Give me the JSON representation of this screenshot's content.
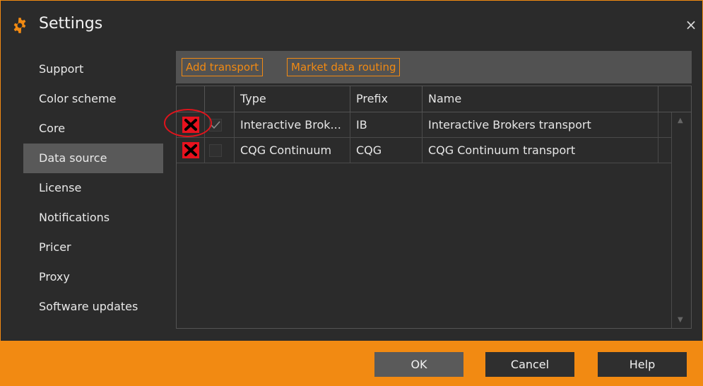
{
  "window": {
    "title": "Settings",
    "close_symbol": "×"
  },
  "sidebar": {
    "items": [
      {
        "label": "Support"
      },
      {
        "label": "Color scheme"
      },
      {
        "label": "Core"
      },
      {
        "label": "Data source",
        "active": true
      },
      {
        "label": "License"
      },
      {
        "label": "Notifications"
      },
      {
        "label": "Pricer"
      },
      {
        "label": "Proxy"
      },
      {
        "label": "Software updates"
      }
    ]
  },
  "toolbar": {
    "add_transport": "Add transport",
    "market_data_routing": "Market data routing"
  },
  "table": {
    "columns": [
      "Type",
      "Prefix",
      "Name"
    ],
    "rows": [
      {
        "type": "Interactive Brok...",
        "prefix": "IB",
        "name": "Interactive Brokers transport",
        "enabled": true
      },
      {
        "type": "CQG Continuum",
        "prefix": "CQG",
        "name": "CQG Continuum transport",
        "enabled": false
      }
    ]
  },
  "footer": {
    "ok": "OK",
    "cancel": "Cancel",
    "help": "Help"
  },
  "colors": {
    "accent": "#F28A12",
    "background": "#2b2b2b",
    "delete": "#e8121e",
    "annotation": "#e0141c"
  },
  "icons": {
    "title": "gear-icon",
    "delete": "x-mark-icon",
    "scroll_up": "triangle-up-icon",
    "scroll_down": "triangle-down-icon"
  }
}
